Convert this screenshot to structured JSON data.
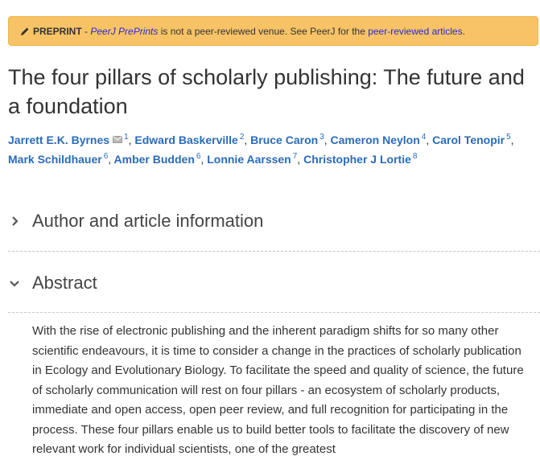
{
  "banner": {
    "tag": "PREPRINT",
    "dash": " - ",
    "venue": "PeerJ PrePrints",
    "message": " is not a peer-reviewed venue. See PeerJ for the ",
    "link": "peer-reviewed articles",
    "end": "."
  },
  "article": {
    "title": "The four pillars of scholarly publishing: The future and a foundation"
  },
  "authors": [
    {
      "name": "Jarrett E.K. Byrnes",
      "affil": "1",
      "email": true
    },
    {
      "name": "Edward Baskerville",
      "affil": "2"
    },
    {
      "name": "Bruce Caron",
      "affil": "3"
    },
    {
      "name": "Cameron Neylon",
      "affil": "4"
    },
    {
      "name": "Carol Tenopir",
      "affil": "5"
    },
    {
      "name": "Mark Schildhauer",
      "affil": "6"
    },
    {
      "name": "Amber Budden",
      "affil": "6"
    },
    {
      "name": "Lonnie Aarssen",
      "affil": "7"
    },
    {
      "name": "Christopher J Lortie",
      "affil": "8"
    }
  ],
  "author_separator": ",",
  "sections": {
    "author_info": {
      "label": "Author and article information",
      "icon": "chevron-right-icon"
    },
    "abstract": {
      "label": "Abstract",
      "icon": "chevron-down-icon"
    }
  },
  "abstract_text": "With the rise of electronic publishing and the inherent paradigm shifts for so many other scientific endeavours, it is time to consider a change in the practices of scholarly publication in Ecology and Evolutionary Biology. To facilitate the speed and quality of science, the future of scholarly communication will rest on four pillars - an ecosystem of scholarly products, immediate and open access, open peer review, and full recognition for participating in the process. These four pillars enable us to build better tools to facilitate the discovery of new relevant work for individual scientists, one of the greatest",
  "colors": {
    "banner_bg": "#f7c366",
    "link": "#2a2ad0",
    "author": "#2a6bb8"
  }
}
